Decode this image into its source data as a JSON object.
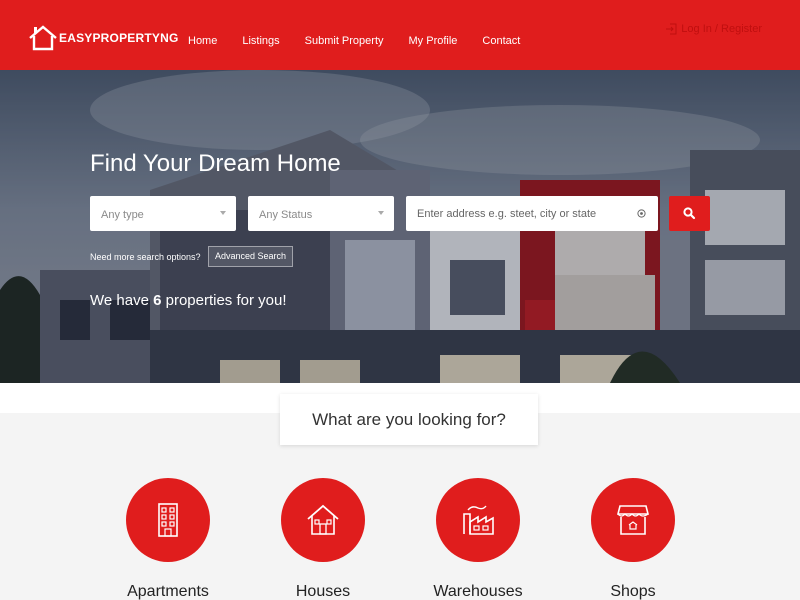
{
  "header": {
    "logo_text": "EASYPROPERTYNG",
    "nav": [
      "Home",
      "Listings",
      "Submit Property",
      "My Profile",
      "Contact"
    ],
    "login_label": "Log In / Register"
  },
  "hero": {
    "title": "Find Your Dream Home",
    "type_select": "Any type",
    "status_select": "Any Status",
    "address_placeholder": "Enter address e.g. steet, city or state",
    "more_options": "Need more search options?",
    "advanced_search": "Advanced Search",
    "count_prefix": "We have ",
    "count_value": "6",
    "count_suffix": " properties for you!"
  },
  "lookfor": {
    "title": "What are you looking for?"
  },
  "categories": [
    {
      "label": "Apartments",
      "icon": "apartment-building-icon"
    },
    {
      "label": "Houses",
      "icon": "house-icon"
    },
    {
      "label": "Warehouses",
      "icon": "factory-icon"
    },
    {
      "label": "Shops",
      "icon": "shop-icon"
    }
  ],
  "colors": {
    "accent": "#e01d1d",
    "white": "#ffffff",
    "text": "#333333"
  }
}
